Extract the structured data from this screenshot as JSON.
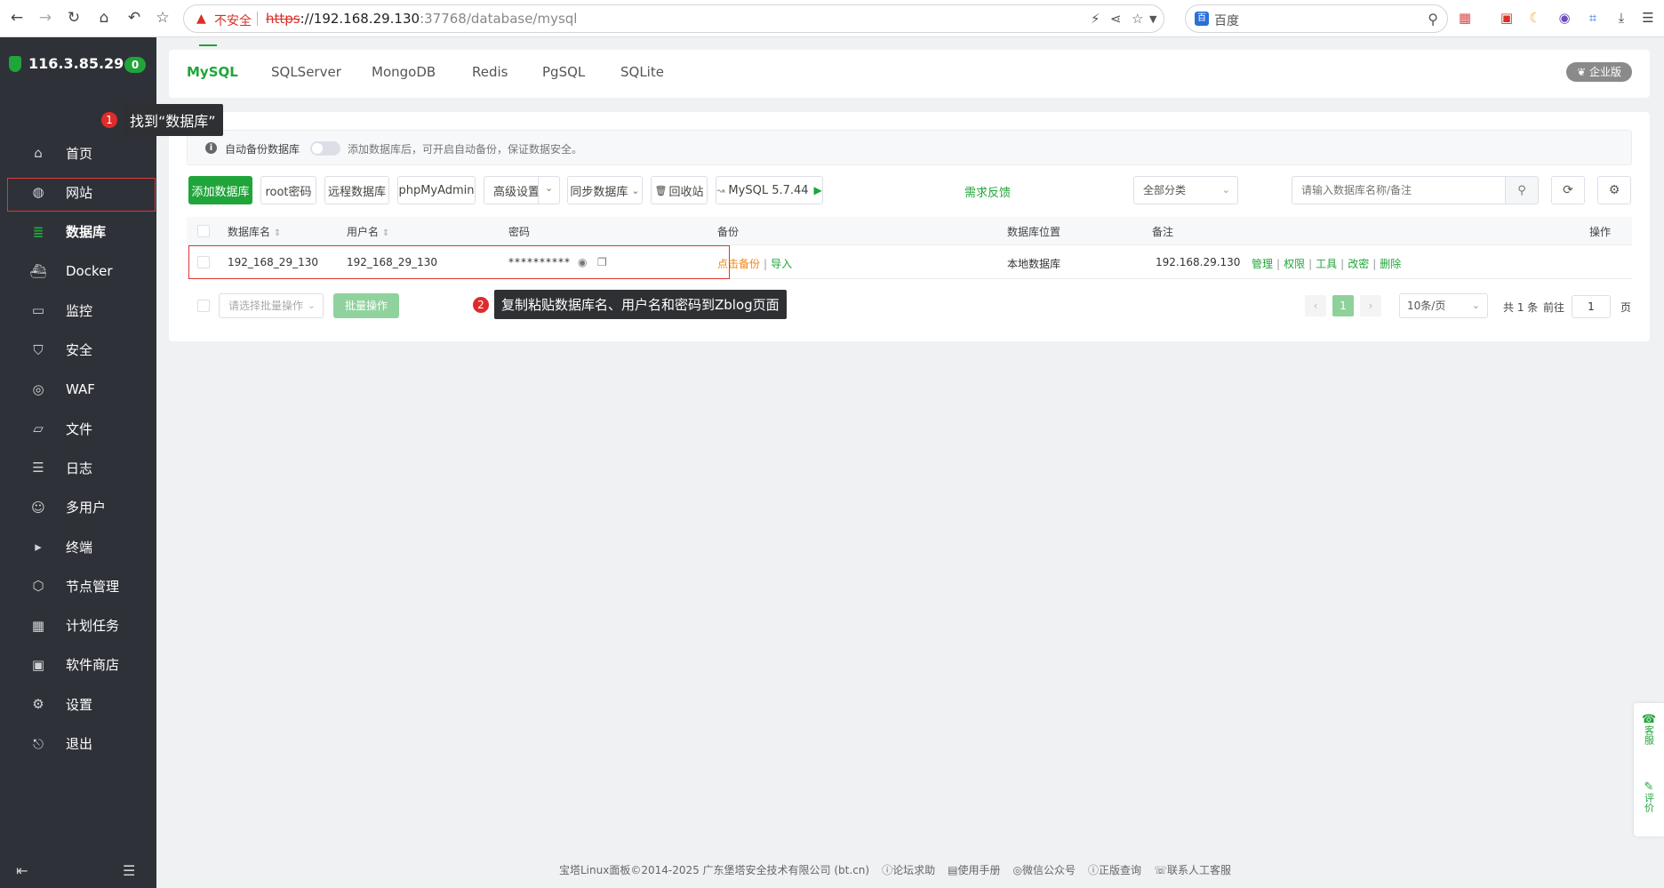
{
  "browser": {
    "unsafe_label": "不安全",
    "url_scheme": "https",
    "url_host": "://192.168.29.130",
    "url_rest": ":37768/database/mysql",
    "search_engine": "百度"
  },
  "sidebar": {
    "server_ip": "116.3.85.29",
    "server_badge": "0",
    "items": [
      {
        "label": "首页",
        "icon": "home-icon"
      },
      {
        "label": "网站",
        "icon": "globe-icon"
      },
      {
        "label": "数据库",
        "icon": "database-icon",
        "active": true
      },
      {
        "label": "Docker",
        "icon": "docker-icon"
      },
      {
        "label": "监控",
        "icon": "monitor-icon"
      },
      {
        "label": "安全",
        "icon": "shield-icon"
      },
      {
        "label": "WAF",
        "icon": "waf-icon"
      },
      {
        "label": "文件",
        "icon": "folder-icon"
      },
      {
        "label": "日志",
        "icon": "log-icon"
      },
      {
        "label": "多用户",
        "icon": "users-icon"
      },
      {
        "label": "终端",
        "icon": "terminal-icon"
      },
      {
        "label": "节点管理",
        "icon": "node-icon"
      },
      {
        "label": "计划任务",
        "icon": "calendar-icon"
      },
      {
        "label": "软件商店",
        "icon": "store-icon"
      },
      {
        "label": "设置",
        "icon": "gear-icon"
      },
      {
        "label": "退出",
        "icon": "logout-icon"
      }
    ]
  },
  "callouts": {
    "one_num": "1",
    "one_text": "找到“数据库”",
    "two_num": "2",
    "two_text": "复制粘贴数据库名、用户名和密码到Zblog页面"
  },
  "tabs": [
    "MySQL",
    "SQLServer",
    "MongoDB",
    "Redis",
    "PgSQL",
    "SQLite"
  ],
  "enterprise_label": "企业版",
  "notice": {
    "auto_backup_label": "自动备份数据库",
    "text": "添加数据库后，可开启自动备份，保证数据安全。"
  },
  "toolbar": {
    "add_db": "添加数据库",
    "root_pwd": "root密码",
    "remote_db": "远程数据库",
    "phpmyadmin": "phpMyAdmin",
    "advanced": "高级设置",
    "sync_db": "同步数据库",
    "recycle": "回收站",
    "mysql_version": "MySQL 5.7.44",
    "feedback": "需求反馈",
    "category": "全部分类",
    "search_placeholder": "请输入数据库名称/备注"
  },
  "table": {
    "headers": {
      "name": "数据库名",
      "user": "用户名",
      "password": "密码",
      "backup": "备份",
      "location": "数据库位置",
      "remark": "备注",
      "ops": "操作"
    },
    "rows": [
      {
        "name": "192_168_29_130",
        "user": "192_168_29_130",
        "password": "**********",
        "backup_action": "点击备份",
        "import_action": "导入",
        "location": "本地数据库",
        "remark": "192.168.29.130",
        "ops": [
          "管理",
          "权限",
          "工具",
          "改密",
          "删除"
        ]
      }
    ]
  },
  "batch": {
    "select_placeholder": "请选择批量操作",
    "button": "批量操作"
  },
  "pagination": {
    "current": "1",
    "per_page": "10条/页",
    "total": "共 1 条",
    "goto_label": "前往",
    "goto_value": "1",
    "page_unit": "页"
  },
  "float": {
    "service": "客服",
    "review": "评价"
  },
  "footer": {
    "copyright": "宝塔Linux面板©2014-2025 广东堡塔安全技术有限公司 (bt.cn)",
    "links": [
      "论坛求助",
      "使用手册",
      "微信公众号",
      "正版查询",
      "联系人工客服"
    ]
  }
}
